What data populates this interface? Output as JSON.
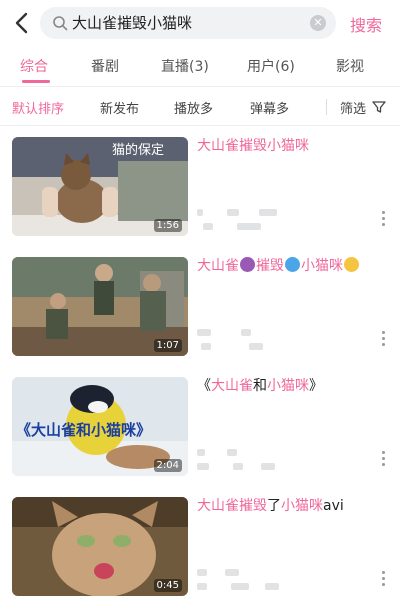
{
  "search": {
    "query": "大山雀摧毁小猫咪",
    "button_label": "搜索",
    "clear_icon": "✕"
  },
  "tabs": [
    {
      "label": "综合",
      "active": true
    },
    {
      "label": "番剧",
      "active": false
    },
    {
      "label": "直播(3)",
      "active": false
    },
    {
      "label": "用户(6)",
      "active": false
    },
    {
      "label": "影视",
      "active": false
    }
  ],
  "filters": [
    {
      "label": "默认排序",
      "active": true
    },
    {
      "label": "新发布",
      "active": false
    },
    {
      "label": "播放多",
      "active": false
    },
    {
      "label": "弹幕多",
      "active": false
    }
  ],
  "filter_button": "筛选",
  "accent_color": "#f0679a",
  "results": [
    {
      "title_parts": [
        {
          "text": "大山雀摧毁小猫咪",
          "hl": true
        }
      ],
      "duration": "1:56",
      "thumb_caption": "猫的保定"
    },
    {
      "title_parts": [
        {
          "text": "大山雀",
          "hl": true
        },
        {
          "emoji": "devil-emoji"
        },
        {
          "text": "摧毁",
          "hl": true
        },
        {
          "emoji": "sweat-droplets-emoji"
        },
        {
          "text": "小猫咪",
          "hl": true
        },
        {
          "emoji": "crying-cat-emoji"
        }
      ],
      "duration": "1:07"
    },
    {
      "title_parts": [
        {
          "text": "《",
          "hl": false
        },
        {
          "text": "大山雀",
          "hl": true
        },
        {
          "text": "和",
          "hl": false
        },
        {
          "text": "小猫咪",
          "hl": true
        },
        {
          "text": "》",
          "hl": false
        }
      ],
      "duration": "2:04",
      "thumb_caption": "《大山雀和小猫咪》"
    },
    {
      "title_parts": [
        {
          "text": "大山雀摧毁",
          "hl": true
        },
        {
          "text": "了",
          "hl": false
        },
        {
          "text": "小猫咪",
          "hl": true
        },
        {
          "text": "avi",
          "hl": false
        }
      ],
      "duration": "0:45"
    }
  ]
}
